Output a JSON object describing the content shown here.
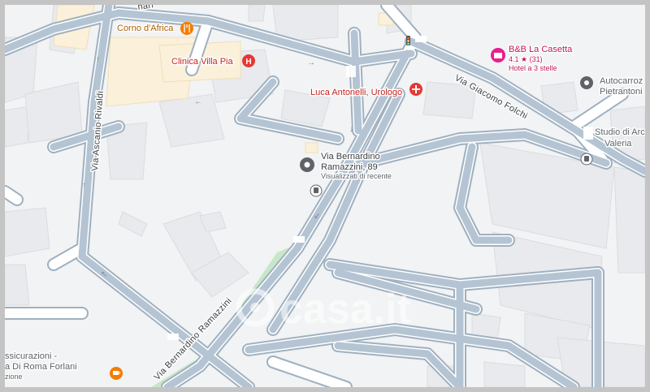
{
  "map": {
    "streets": [
      {
        "id": "via-ascanio-rivaldi",
        "label": "Via Ascanio Rivaldi"
      },
      {
        "id": "via-giacomo-folchi",
        "label": "Via Giacomo Folchi"
      },
      {
        "id": "via-bernardino-ramazzini",
        "label": "Via Bernardino Ramazzini"
      },
      {
        "id": "top-partial",
        "label": "nari"
      }
    ],
    "pois": [
      {
        "id": "corno-dafrica",
        "label": "Corno d'Africa",
        "icon": "restaurant-icon",
        "color": "#f57c00"
      },
      {
        "id": "clinica-villa-pia",
        "label": "Clinica Villa Pia",
        "icon": "hospital-icon",
        "color": "#e53935"
      },
      {
        "id": "luca-antonelli",
        "label": "Luca Antonelli, Urologo",
        "icon": "medical-icon",
        "color": "#e53935"
      },
      {
        "id": "bb-la-casetta",
        "label": "B&B La Casetta",
        "rating": "4.1 ★ (31)",
        "category": "Hotel a 3 stelle",
        "icon": "hotel-icon",
        "color": "#e91e90"
      },
      {
        "id": "autocarrozzeria",
        "line1": "Autocarroz",
        "line2": "Pietrantoni",
        "icon": "pin-icon",
        "color": "#5f6368"
      },
      {
        "id": "studio",
        "line1": "Studio di Arc",
        "line2": "Valeria",
        "icon": "none"
      },
      {
        "id": "assicurazioni",
        "line1": "ssicurazioni -",
        "line2": "a Di Roma Forlani",
        "line3": "zione",
        "icon": "coffee-icon",
        "color": "#f57c00"
      }
    ],
    "selected_place": {
      "line1": "Via Bernardino",
      "line2": "Ramazzini, 89",
      "sub": "Visualizzati di recente",
      "icon": "pin-icon"
    },
    "watermark": "casa.it"
  }
}
